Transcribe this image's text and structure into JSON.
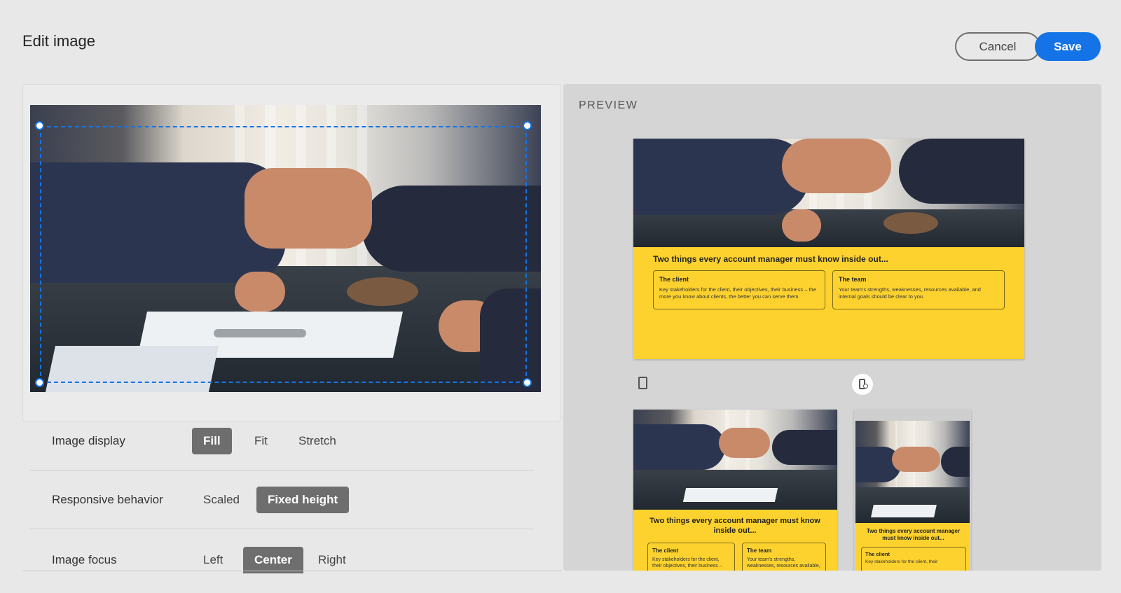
{
  "header": {
    "title": "Edit image",
    "cancel_label": "Cancel",
    "save_label": "Save"
  },
  "controls": {
    "image_display": {
      "label": "Image display",
      "options": [
        "Fill",
        "Fit",
        "Stretch"
      ],
      "selected": "Fill"
    },
    "responsive": {
      "label": "Responsive behavior",
      "options": [
        "Scaled",
        "Fixed height"
      ],
      "selected": "Fixed height"
    },
    "focus": {
      "label": "Image focus",
      "options": [
        "Left",
        "Center",
        "Right"
      ],
      "selected": "Center"
    }
  },
  "preview": {
    "label": "PREVIEW",
    "card": {
      "heading": "Two things every account manager must know inside out...",
      "client_title": "The client",
      "client_body": "Key stakeholders for the client, their objectives, their business – the more you know about clients, the better you can serve them.",
      "team_title": "The team",
      "team_body": "Your team's strengths, weaknesses, resources available, and internal goals should be clear to you.",
      "tablet_heading": "Two things every account manager must know inside out...",
      "tablet_client_body": "Key stakeholders for the client, their objectives, their business –",
      "tablet_team_body": "Your team's strengths, weaknesses, resources available,",
      "mobile_heading": "Two things every account manager must know inside out...",
      "mobile_client_body": "Key stakeholders for the client, their"
    },
    "devices": [
      "tablet-icon",
      "mobile-icon"
    ]
  },
  "colors": {
    "accent": "#1473e6",
    "card_yellow": "#fdd22e",
    "selected_option": "#6e6e6e"
  }
}
